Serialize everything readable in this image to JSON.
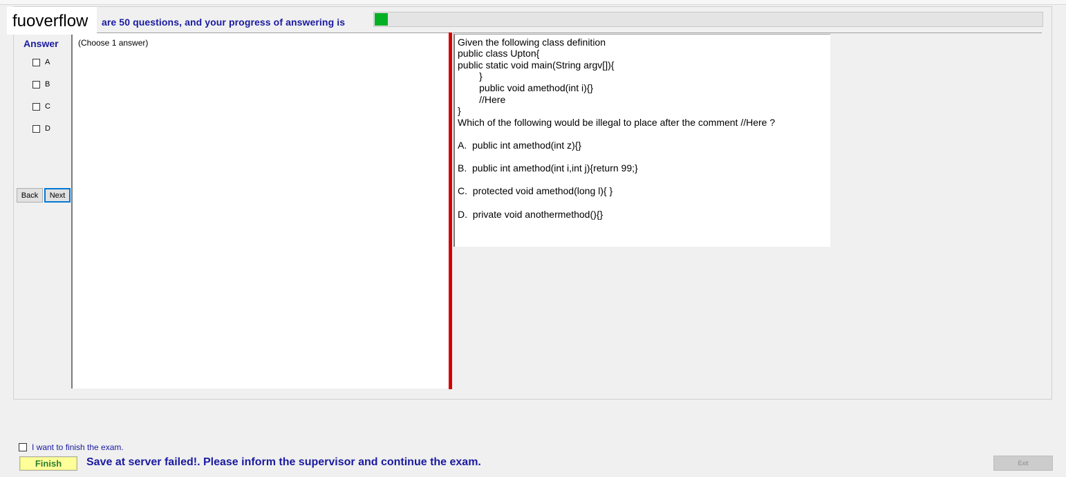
{
  "brand": "fuoverflow",
  "progress": {
    "text": "are 50 questions, and your progress of answering is",
    "fraction": 0.02,
    "fill_color": "#06b025"
  },
  "answer_panel": {
    "title": "Answer",
    "options": [
      "A",
      "B",
      "C",
      "D"
    ],
    "back_label": "Back",
    "next_label": "Next"
  },
  "left_pane": {
    "choose_text": "(Choose 1 answer)"
  },
  "question": {
    "lines": [
      "Given the following class definition",
      "public class Upton{",
      "public static void main(String argv[]){",
      "        }",
      "        public void amethod(int i){}",
      "        //Here",
      "}",
      "Which of the following would be illegal to place after the comment //Here ?",
      "A.  public int amethod(int z){}",
      "B.  public int amethod(int i,int j){return 99;}",
      "C.  protected void amethod(long l){ }",
      "D.  private void anothermethod(){}"
    ]
  },
  "footer": {
    "finish_check_label": "I want to finish the exam.",
    "finish_button": "Finish",
    "save_message": "Save at server failed!. Please inform the supervisor and continue the exam.",
    "exit_button": "Exit"
  }
}
